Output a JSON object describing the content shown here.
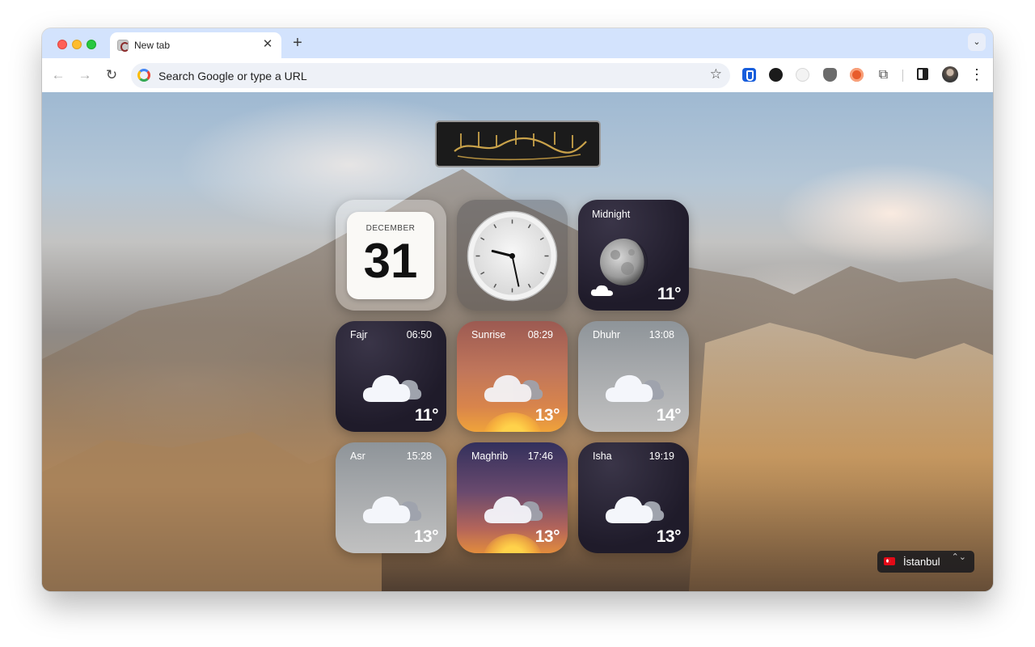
{
  "browser": {
    "tab_title": "New tab",
    "tab_close_glyph": "✕",
    "new_tab_glyph": "+",
    "tab_search_glyph": "⌄",
    "back_glyph": "←",
    "forward_glyph": "→",
    "reload_glyph": "↻",
    "omnibox_placeholder": "Search Google or type a URL",
    "bookmark_glyph": "☆",
    "extensions_glyph": "⧉",
    "menu_glyph": "⋮"
  },
  "calendar": {
    "month": "DECEMBER",
    "day": "31"
  },
  "clock": {
    "hours": 9,
    "minutes": 28
  },
  "moon_widget": {
    "label": "Midnight",
    "temp": "11°"
  },
  "prayers": [
    {
      "name": "Fajr",
      "time": "06:50",
      "temp": "11°"
    },
    {
      "name": "Sunrise",
      "time": "08:29",
      "temp": "13°"
    },
    {
      "name": "Dhuhr",
      "time": "13:08",
      "temp": "14°"
    },
    {
      "name": "Asr",
      "time": "15:28",
      "temp": "13°"
    },
    {
      "name": "Maghrib",
      "time": "17:46",
      "temp": "13°"
    },
    {
      "name": "Isha",
      "time": "19:19",
      "temp": "13°"
    }
  ],
  "location": {
    "city": "İstanbul",
    "caret": "⌃⌄"
  },
  "colors": {
    "accent": "#1a73e8",
    "tab_strip": "#d3e3fd"
  }
}
